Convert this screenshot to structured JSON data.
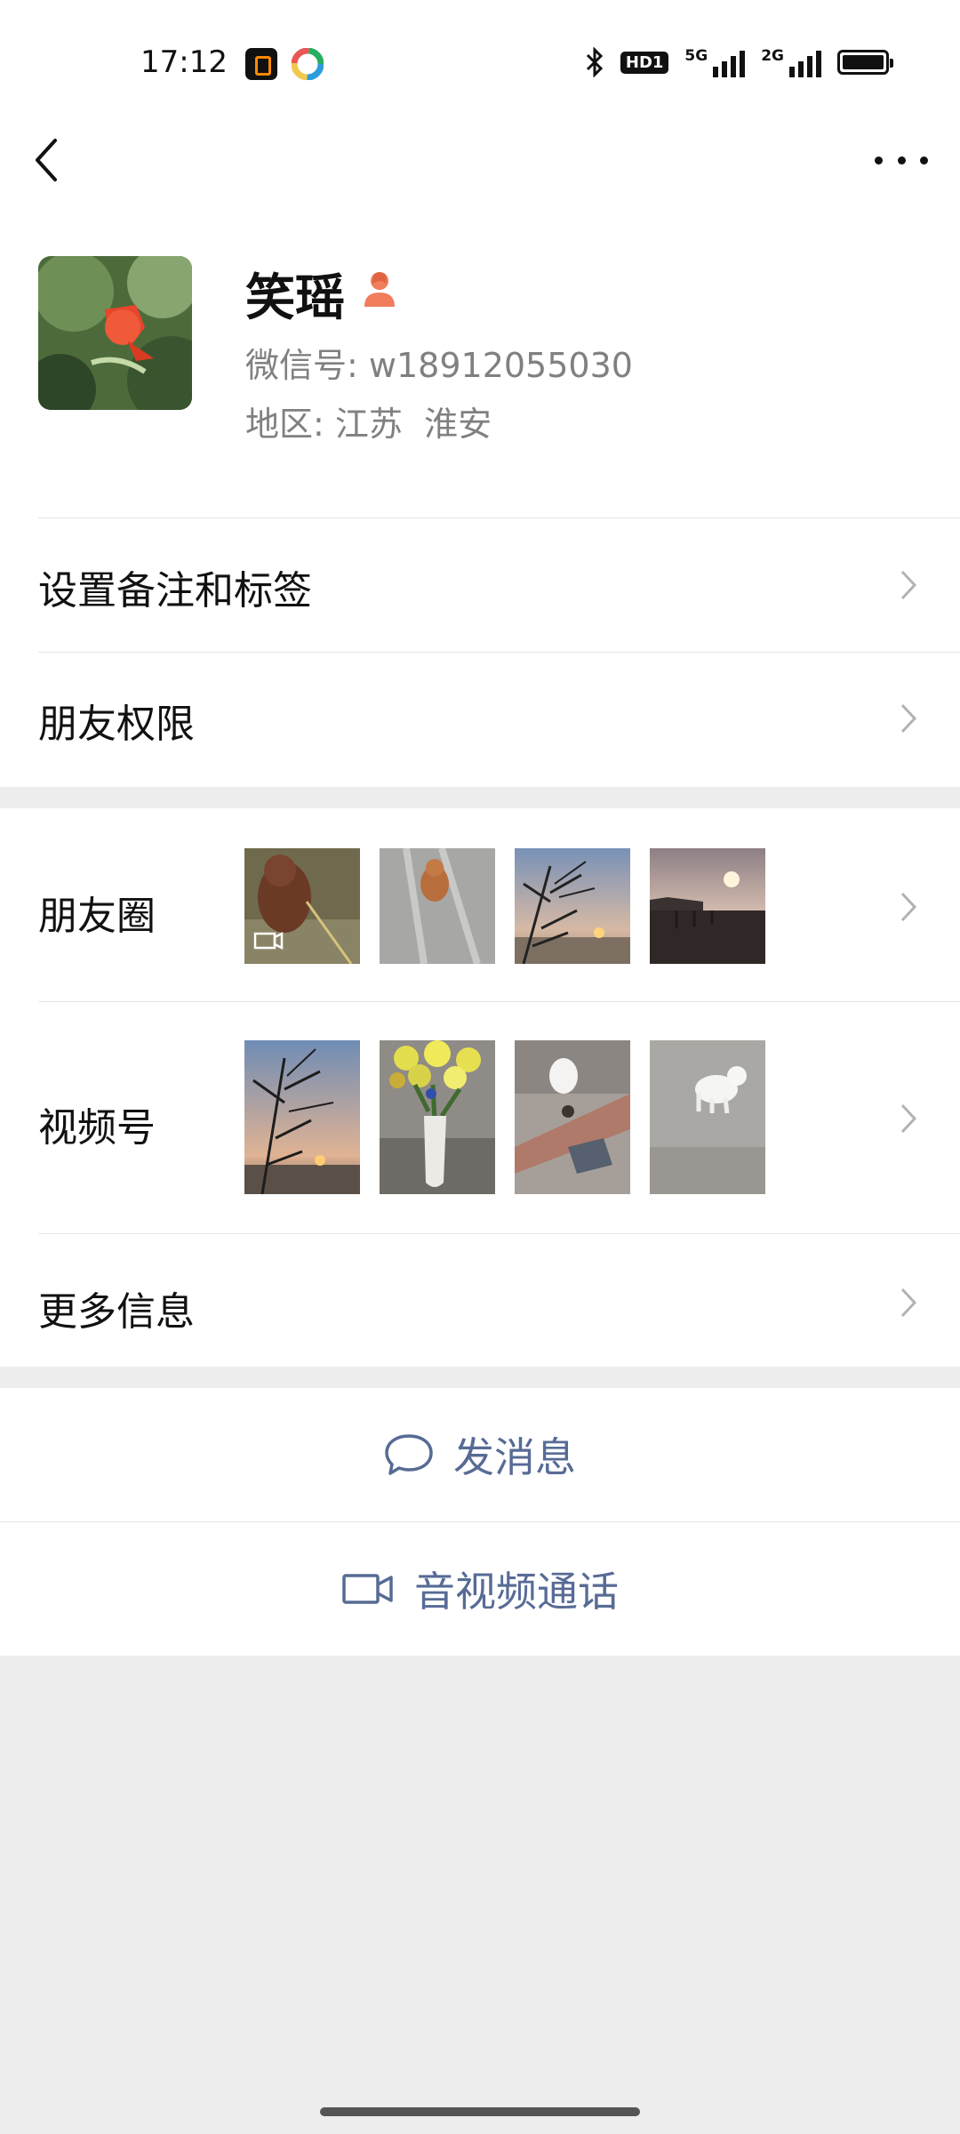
{
  "status_bar": {
    "time": "17:12",
    "hd_badge": "HD1",
    "network_1": "5G",
    "network_2": "2G",
    "icons": [
      "app-icon-orange",
      "app-icon-color-wheel",
      "bluetooth-icon",
      "hd-icon",
      "signal-5g-icon",
      "signal-2g-icon",
      "battery-icon"
    ]
  },
  "profile": {
    "name": "笑瑶",
    "wechat_id_label": "微信号:",
    "wechat_id": "w18912055030",
    "region_label": "地区:",
    "region": "江苏  淮安",
    "gender_icon_color": "#f07d5c"
  },
  "menu": {
    "remark_tags": "设置备注和标签",
    "friend_permissions": "朋友权限",
    "moments": "朋友圈",
    "channels": "视频号",
    "more_info": "更多信息"
  },
  "actions": {
    "send_message": "发消息",
    "voice_video_call": "音视频通话",
    "link_color": "#576b95"
  },
  "icons": {
    "back": "back-arrow-icon",
    "more": "more-dots-icon",
    "chevron": "chevron-right-icon",
    "message": "message-bubble-icon",
    "video": "video-camera-icon"
  }
}
